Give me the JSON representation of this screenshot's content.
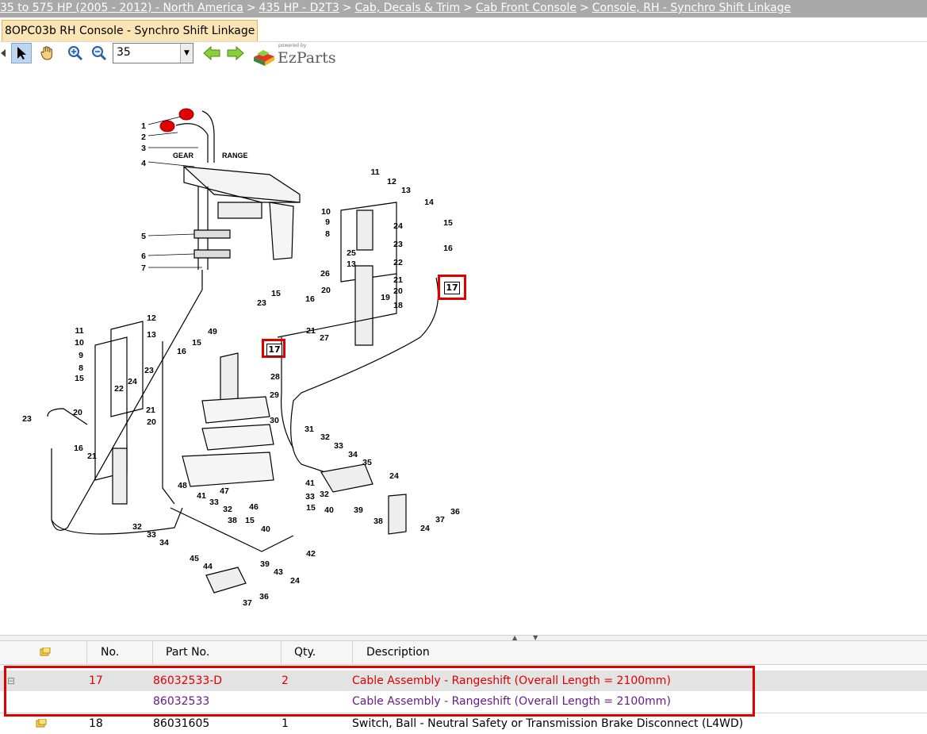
{
  "breadcrumb": {
    "items": [
      "35 to 575 HP (2005 - 2012) - North America",
      "435 HP - D2T3",
      "Cab, Decals & Trim",
      "Cab Front Console",
      "Console, RH - Synchro Shift Linkage"
    ],
    "separator": ">"
  },
  "tab": {
    "label": "8OPC03b RH Console - Synchro Shift Linkage"
  },
  "toolbar": {
    "zoom_value": "35",
    "logo_powered": "powered by",
    "logo_text": "EzParts"
  },
  "diagram": {
    "section_labels": {
      "gear": "GEAR",
      "range": "RANGE"
    },
    "callout_number": "17",
    "callouts": [
      "1",
      "2",
      "3",
      "4",
      "5",
      "6",
      "7",
      "8",
      "9",
      "10",
      "11",
      "12",
      "13",
      "14",
      "15",
      "16",
      "17",
      "18",
      "19",
      "20",
      "21",
      "22",
      "23",
      "24",
      "25",
      "26",
      "27",
      "28",
      "29",
      "30",
      "31",
      "32",
      "33",
      "34",
      "35",
      "36",
      "37",
      "38",
      "39",
      "40",
      "41",
      "42",
      "43",
      "44",
      "45",
      "46",
      "47",
      "48",
      "49"
    ]
  },
  "parts_table": {
    "headers": {
      "no": "No.",
      "part_no": "Part No.",
      "qty": "Qty.",
      "description": "Description"
    },
    "rows": [
      {
        "no": "17",
        "part_no": "86032533-D",
        "qty": "2",
        "description": "Cable Assembly - Rangeshift (Overall Length = 2100mm)",
        "expander": "⊟"
      },
      {
        "no": "",
        "part_no": "86032533",
        "qty": "",
        "description": "Cable Assembly - Rangeshift (Overall Length = 2100mm)"
      },
      {
        "no": "18",
        "part_no": "86031605",
        "qty": "1",
        "description": "Switch, Ball - Neutral Safety or Transmission Brake Disconnect (L4WD)"
      }
    ]
  },
  "colors": {
    "highlight": "#e00000",
    "breadcrumb_bg": "#a9a9a9",
    "tab_bg": "#fbe5b5",
    "selected_text": "#e00000",
    "subpart_text": "#6a1b8a"
  },
  "icons": [
    "pointer-icon",
    "hand-icon",
    "zoom-in-icon",
    "zoom-out-icon",
    "back-arrow-icon",
    "forward-arrow-icon",
    "ezparts-logo-icon",
    "note-icon"
  ]
}
